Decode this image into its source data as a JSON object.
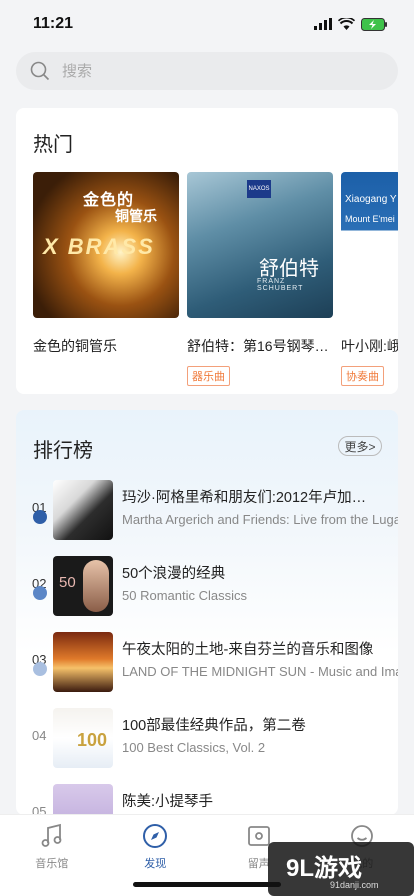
{
  "status_bar": {
    "time": "11:21"
  },
  "search": {
    "placeholder": "搜索"
  },
  "hot": {
    "title": "热门",
    "albums": [
      {
        "name": "金色的铜管乐",
        "cover_text_1": "金色的",
        "cover_text_2": "铜管乐",
        "cover_text_3": "X BRASS"
      },
      {
        "name": "舒伯特：第16号钢琴…",
        "tag": "器乐曲",
        "cover_text_1": "舒伯特",
        "cover_text_2": "FRANZ SCHUBERT",
        "cover_brand": "NAXOS"
      },
      {
        "name": "叶小刚:峨",
        "tag": "协奏曲",
        "cover_text_1": "Xiaogang Y",
        "cover_text_2": "Mount E'mei"
      }
    ]
  },
  "chart": {
    "title": "排行榜",
    "more_label": "更多>",
    "items": [
      {
        "rank": "01",
        "title": "玛沙·阿格里希和朋友们:2012年卢加…",
        "subtitle": "Martha Argerich and Friends: Live from the Lugano"
      },
      {
        "rank": "02",
        "title": "50个浪漫的经典",
        "subtitle": "50 Romantic Classics",
        "cover_text": "50"
      },
      {
        "rank": "03",
        "title": "午夜太阳的土地-来自芬兰的音乐和图像",
        "subtitle": "LAND OF THE MIDNIGHT SUN - Music and Images"
      },
      {
        "rank": "04",
        "title": "100部最佳经典作品，第二卷",
        "subtitle": "100 Best Classics, Vol. 2",
        "cover_text": "100"
      },
      {
        "rank": "05",
        "title": "陈美:小提琴手",
        "subtitle": ""
      }
    ]
  },
  "tabs": [
    {
      "label": "音乐馆",
      "icon": "music-note-icon"
    },
    {
      "label": "发现",
      "icon": "compass-icon",
      "active": true
    },
    {
      "label": "留声",
      "icon": "tape-icon"
    },
    {
      "label": "我的",
      "icon": "profile-icon"
    }
  ],
  "watermark": {
    "text": "9L游戏",
    "sub": "91danji.com"
  },
  "colors": {
    "accent": "#2f5fa8",
    "tag": "#f07a3a",
    "rank_dot": "#3b6cb8"
  }
}
